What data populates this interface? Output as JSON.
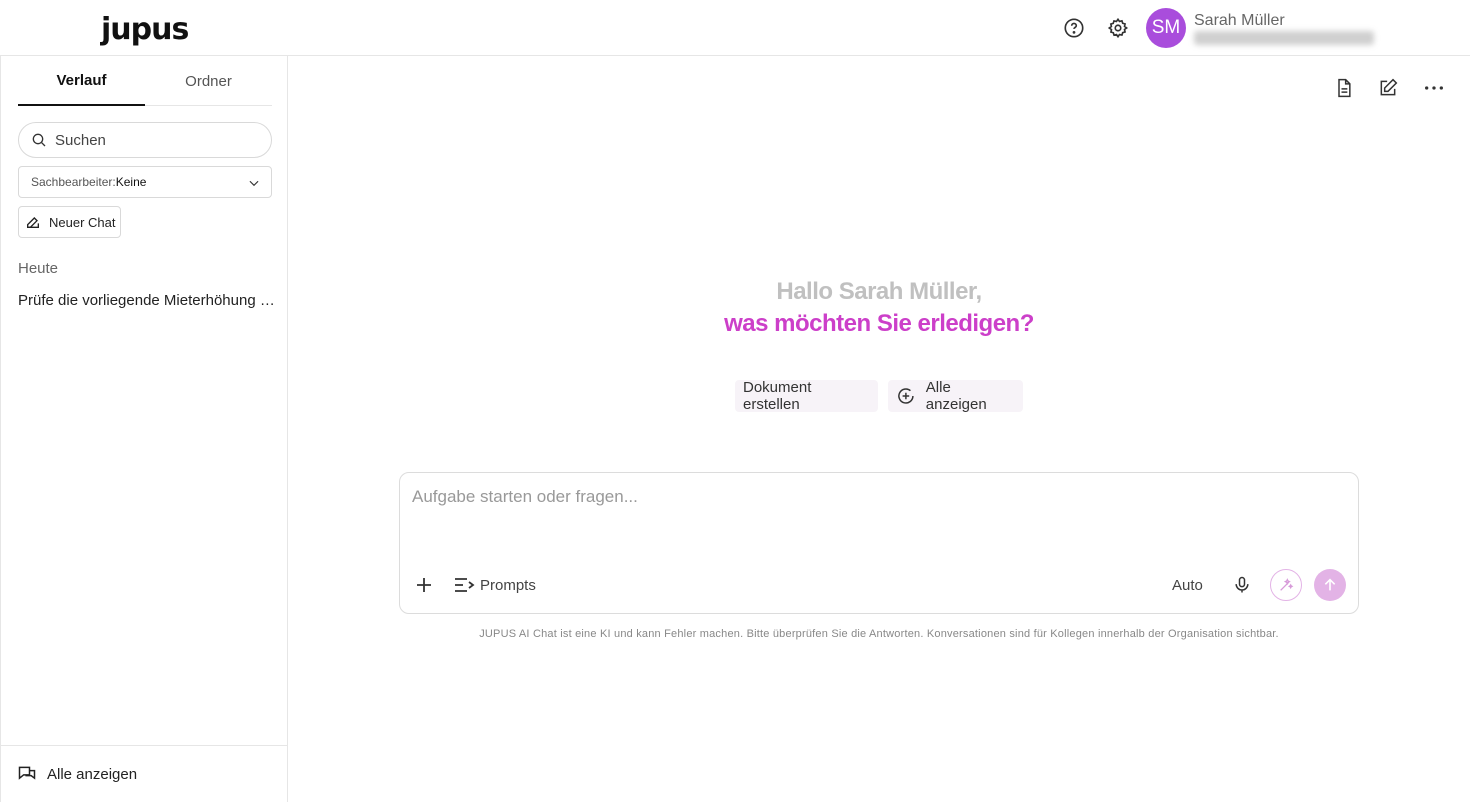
{
  "header": {
    "logo": "jupus",
    "user": {
      "initials": "SM",
      "name": "Sarah Müller"
    },
    "colors": {
      "avatar": "#a94ddc"
    }
  },
  "sidebar": {
    "tabs": [
      {
        "label": "Verlauf",
        "active": true
      },
      {
        "label": "Ordner",
        "active": false
      }
    ],
    "search": {
      "placeholder": "Suchen"
    },
    "filter": {
      "label": "Sachbearbeiter:",
      "value": "Keine"
    },
    "new_chat_label": "Neuer Chat",
    "section_label": "Heute",
    "chats": [
      {
        "title": "Prüfe die vorliegende Mieterhöhung auf Richtigkeit"
      }
    ],
    "footer_label": "Alle anzeigen"
  },
  "main": {
    "greeting_line1": "Hallo Sarah Müller,",
    "greeting_line2": "was möchten Sie erledigen?",
    "chips": [
      {
        "label": "Dokument erstellen"
      },
      {
        "label": "Alle anzeigen"
      }
    ],
    "composer": {
      "placeholder": "Aufgabe starten oder fragen...",
      "prompts_label": "Prompts",
      "model_label": "Auto"
    },
    "disclaimer": "JUPUS AI Chat ist eine KI und kann Fehler machen. Bitte überprüfen Sie die Antworten. Konversationen sind für Kollegen innerhalb der Organisation sichtbar.",
    "colors": {
      "accent": "#cc3fc9",
      "send": "#e3b3e6"
    }
  }
}
